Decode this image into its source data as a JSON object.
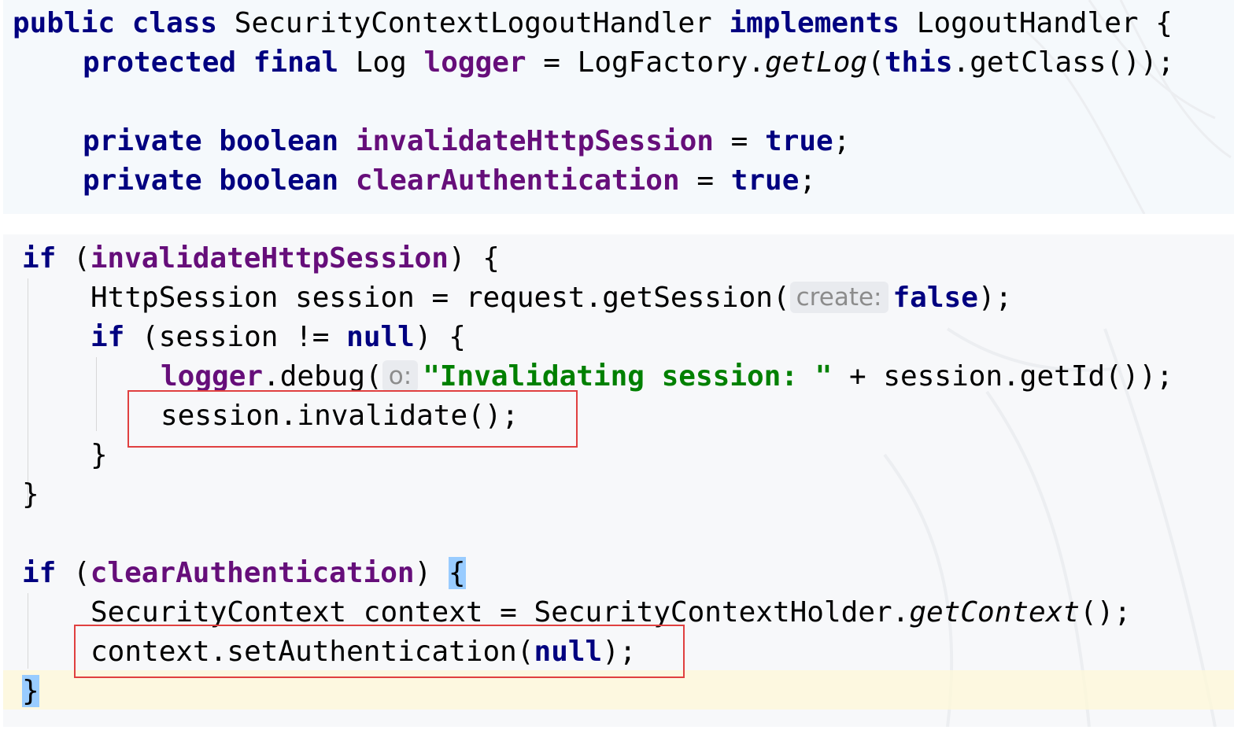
{
  "colors": {
    "keyword": "#000080",
    "field": "#660e7a",
    "string": "#008000",
    "hint_text": "#8c8c8c",
    "highlight_box": "#e04040",
    "brace_match": "#99ccff",
    "current_line": "#fff8d7"
  },
  "top_snippet": {
    "line1": {
      "kw_public": "public",
      "kw_class": "class",
      "class_name": "SecurityContextLogoutHandler",
      "kw_implements": "implements",
      "iface": "LogoutHandler",
      "open": "{"
    },
    "line2": {
      "kw_protected": "protected",
      "kw_final": "final",
      "type": "Log",
      "field": "logger",
      "eq": "=",
      "factory": "LogFactory.",
      "method": "getLog",
      "paren_open": "(",
      "kw_this": "this",
      "rest": ".getClass());"
    },
    "line4": {
      "kw_private": "private",
      "kw_boolean": "boolean",
      "field": "invalidateHttpSession",
      "eq": "=",
      "kw_true": "true",
      "semi": ";"
    },
    "line5": {
      "kw_private": "private",
      "kw_boolean": "boolean",
      "field": "clearAuthentication",
      "eq": "=",
      "kw_true": "true",
      "semi": ";"
    }
  },
  "bottom_snippet": {
    "l1": {
      "kw_if": "if",
      "paren": "(",
      "field": "invalidateHttpSession",
      "close": ") {"
    },
    "l2": {
      "text": "HttpSession session = request.getSession(",
      "hint": "create:",
      "kw_false": "false",
      "close": ");"
    },
    "l3": {
      "kw_if": "if",
      "mid": "(session != ",
      "kw_null": "null",
      "close": ") {"
    },
    "l4": {
      "field": "logger",
      "call": ".debug(",
      "hint": "o:",
      "str": "\"Invalidating session: \"",
      "rest": " + session.getId());"
    },
    "l5": {
      "text": "session.invalidate();"
    },
    "l6": {
      "text": "}"
    },
    "l7": {
      "text": "}"
    },
    "l9": {
      "kw_if": "if",
      "paren": "(",
      "field": "clearAuthentication",
      "close": ") ",
      "brace": "{"
    },
    "l10": {
      "text": "SecurityContext context = SecurityContextHolder.",
      "method": "getContext",
      "close": "();"
    },
    "l11": {
      "text": "context.setAuthentication(",
      "kw_null": "null",
      "close": ");"
    },
    "l12": {
      "brace": "}"
    }
  }
}
